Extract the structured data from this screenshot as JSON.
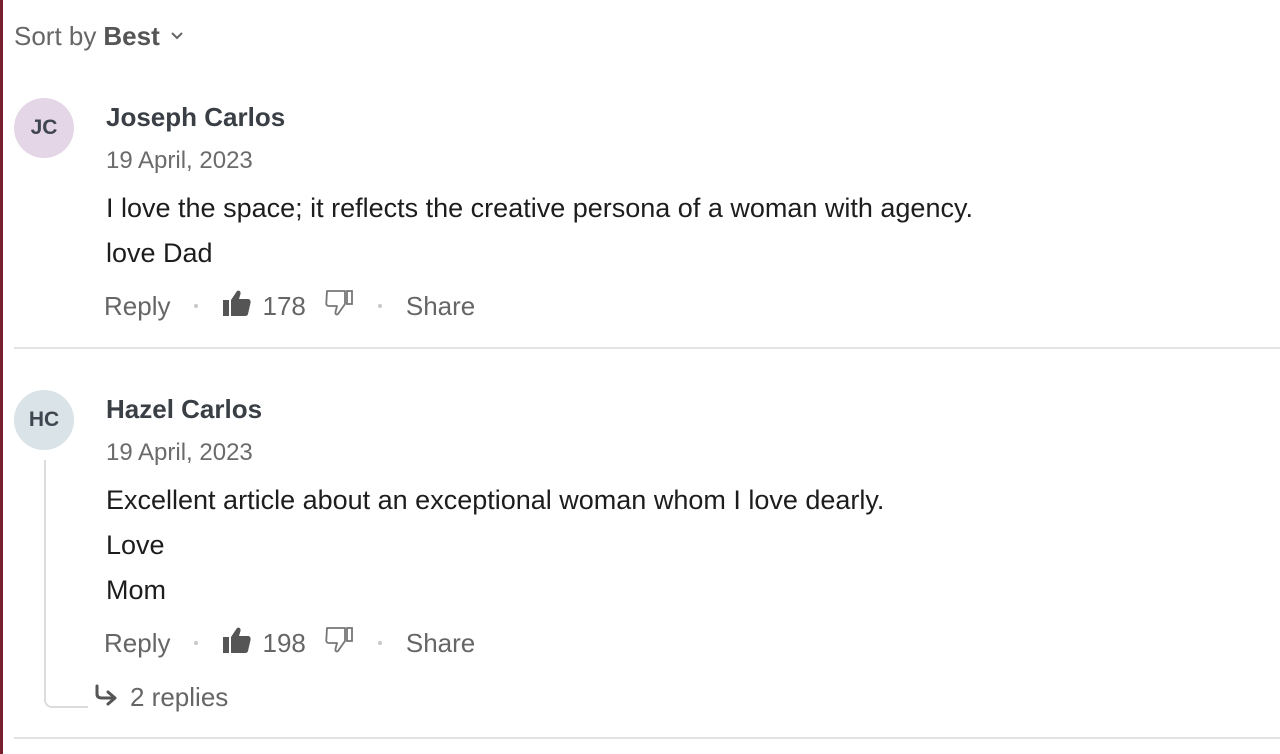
{
  "sort": {
    "label": "Sort by",
    "value": "Best"
  },
  "comments": [
    {
      "initials": "JC",
      "avatar_color": "#e4d5e7",
      "author": "Joseph Carlos",
      "date": "19 April, 2023",
      "lines": [
        "I love the space; it reflects the creative persona of a woman with agency.",
        "love Dad"
      ],
      "reply_label": "Reply",
      "likes": "178",
      "share_label": "Share"
    },
    {
      "initials": "HC",
      "avatar_color": "#d9e3e8",
      "author": "Hazel Carlos",
      "date": "19 April, 2023",
      "lines": [
        "Excellent article about an exceptional woman whom I love dearly.",
        "Love",
        "Mom"
      ],
      "reply_label": "Reply",
      "likes": "198",
      "share_label": "Share",
      "replies_label": "2 replies"
    }
  ],
  "icons": {
    "sort_chevron": "chevron-down-icon",
    "like": "thumbs-up-icon",
    "dislike": "thumbs-down-icon",
    "replies_arrow": "reply-arrow-icon"
  },
  "colors": {
    "text_muted": "#666666",
    "author": "#3a3f45",
    "divider": "#e3e3e3",
    "left_edge": "#7a1f2e"
  }
}
